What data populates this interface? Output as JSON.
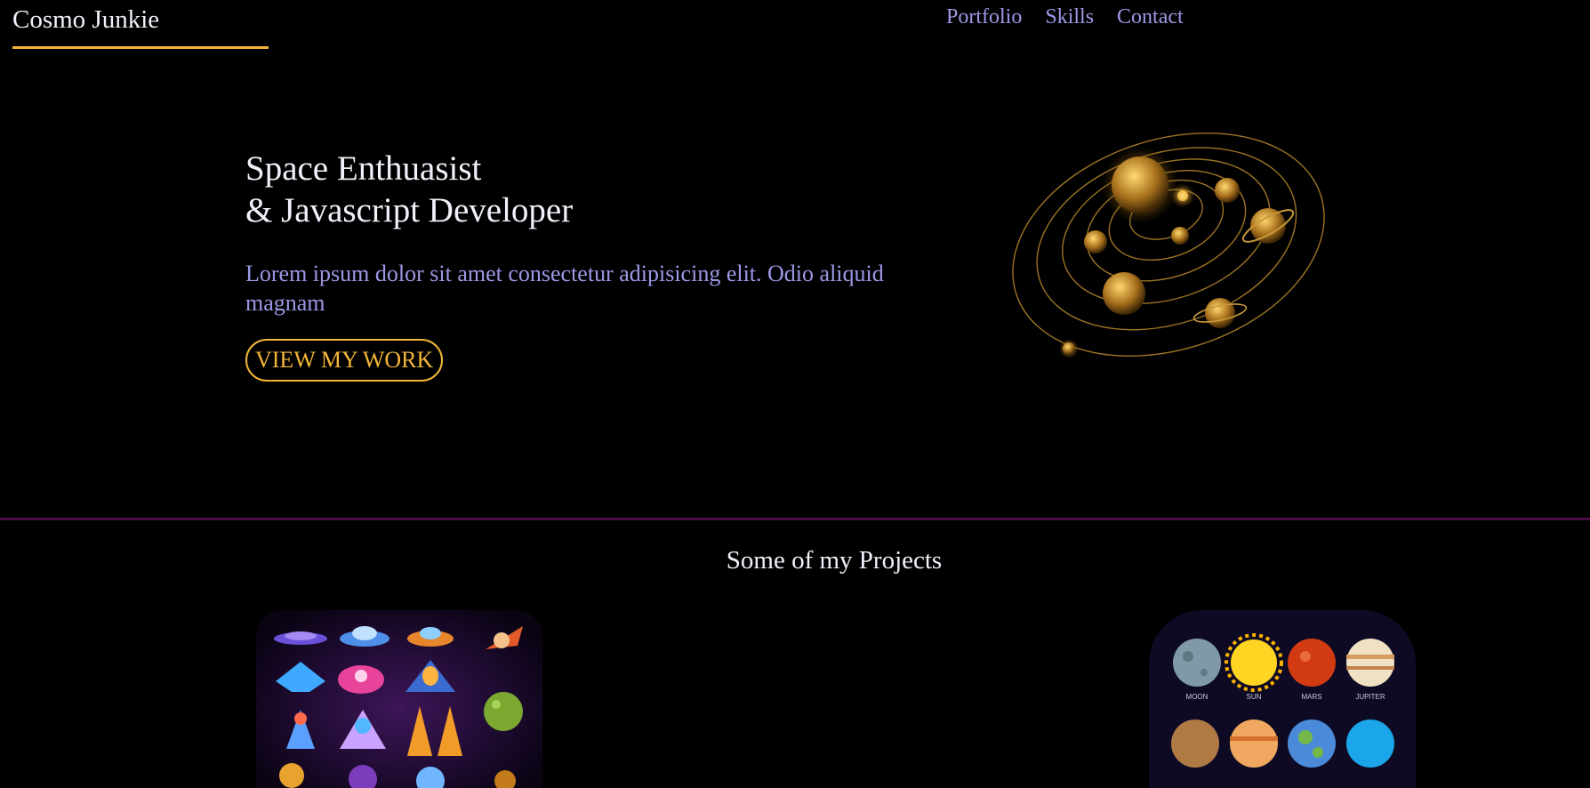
{
  "header": {
    "brand": "Cosmo Junkie",
    "nav": [
      "Portfolio",
      "Skills",
      "Contact"
    ]
  },
  "hero": {
    "title_line1": "Space Enthuasist",
    "title_line2": "& Javascript Developer",
    "description": "Lorem ipsum dolor sit amet consectetur adipisicing elit. Odio aliquid magnam",
    "cta_label": "VIEW MY WORK"
  },
  "projects": {
    "title": "Some of my Projects",
    "planet_labels": [
      "MOON",
      "SUN",
      "MARS",
      "JUPITER"
    ]
  },
  "colors": {
    "background": "#000000",
    "accent": "#f4b63a",
    "nav_text": "#9c98e6",
    "divider": "#4a0d4a"
  }
}
